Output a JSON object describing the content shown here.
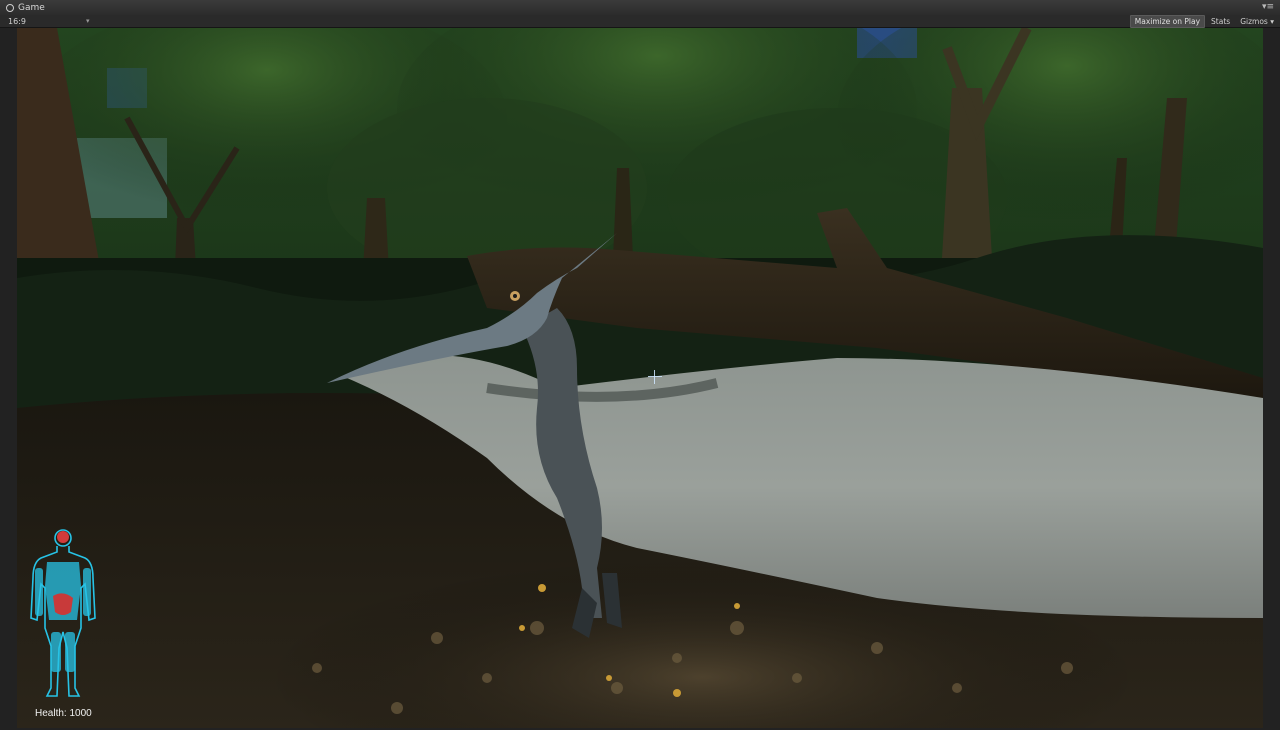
{
  "window": {
    "tab_title": "Game",
    "controls": "▾≡"
  },
  "toolbar": {
    "aspect": "16:9",
    "aspect_caret": "▾",
    "maximize_label": "Maximize on Play",
    "stats_label": "Stats",
    "gizmos_label": "Gizmos",
    "gizmos_caret": "▾"
  },
  "hud": {
    "health_text": "Health: 1000"
  },
  "colors": {
    "accent_cyan": "#27c3e6",
    "brain_red": "#d23b3b",
    "stomach_red": "#c83a3a"
  },
  "icons": {
    "tab_icon": "unity-icon",
    "hud_icon": "human-body-icon",
    "center": "crosshair-icon"
  }
}
